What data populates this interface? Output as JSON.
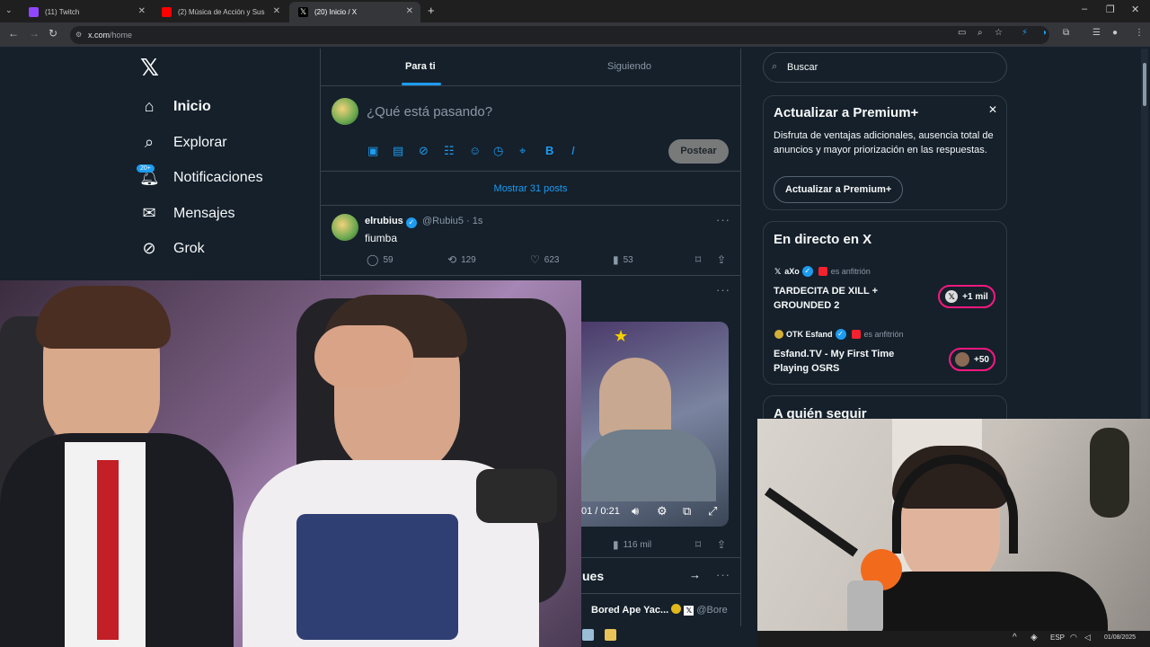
{
  "browser": {
    "tabs": [
      {
        "label": "(11) Twitch",
        "color": "#9146ff"
      },
      {
        "label": "(2) Música de Acción y Sus",
        "color": "#ff0000"
      },
      {
        "label": "(20) Inicio / X",
        "color": "#000000"
      }
    ],
    "url_host": "x.com",
    "url_path": "/home"
  },
  "nav": {
    "items": [
      {
        "label": "Inicio",
        "icon": "home-icon"
      },
      {
        "label": "Explorar",
        "icon": "search-icon"
      },
      {
        "label": "Notificaciones",
        "icon": "bell-icon"
      },
      {
        "label": "Mensajes",
        "icon": "mail-icon"
      },
      {
        "label": "Grok",
        "icon": "grok-icon"
      }
    ],
    "notif_badge": "20+"
  },
  "feed": {
    "tabs": [
      "Para ti",
      "Siguiendo"
    ],
    "composer_placeholder": "¿Qué está pasando?",
    "post_label": "Postear",
    "show_posts": "Mostrar 31 posts",
    "tweet": {
      "name": "elrubius",
      "handle": "@Rubiu5 · 1s",
      "text": "fiumba",
      "replies": "59",
      "retweets": "129",
      "likes": "623",
      "views": "53"
    },
    "video": {
      "time": "01 / 0:21",
      "views": "116 mil"
    },
    "section_partial": "ues",
    "follow_partial": "Bored Ape Yac...",
    "follow_handle": "@Bore"
  },
  "sidebar": {
    "search_placeholder": "Buscar",
    "premium": {
      "title": "Actualizar a Premium+",
      "desc": "Disfruta de ventajas adicionales, ausencia total de anuncios y mayor priorización en las respuestas.",
      "button": "Actualizar a Premium+"
    },
    "live": {
      "title": "En directo en X",
      "items": [
        {
          "host": "aXo",
          "role": "es anfitrión",
          "title": "TARDECITA DE XILL + GROUNDED 2",
          "count": "+1 mil"
        },
        {
          "host": "OTK Esfand",
          "role": "es anfitrión",
          "title": "Esfand.TV - My First Time Playing OSRS",
          "count": "+50"
        }
      ]
    },
    "who_to_follow": "A quién seguir"
  },
  "taskbar": {
    "date": "01/08/2025",
    "lang": "ESP"
  },
  "colors": {
    "background": "#15202b",
    "accent": "#1d9bf0",
    "live_pink": "#f91880"
  }
}
